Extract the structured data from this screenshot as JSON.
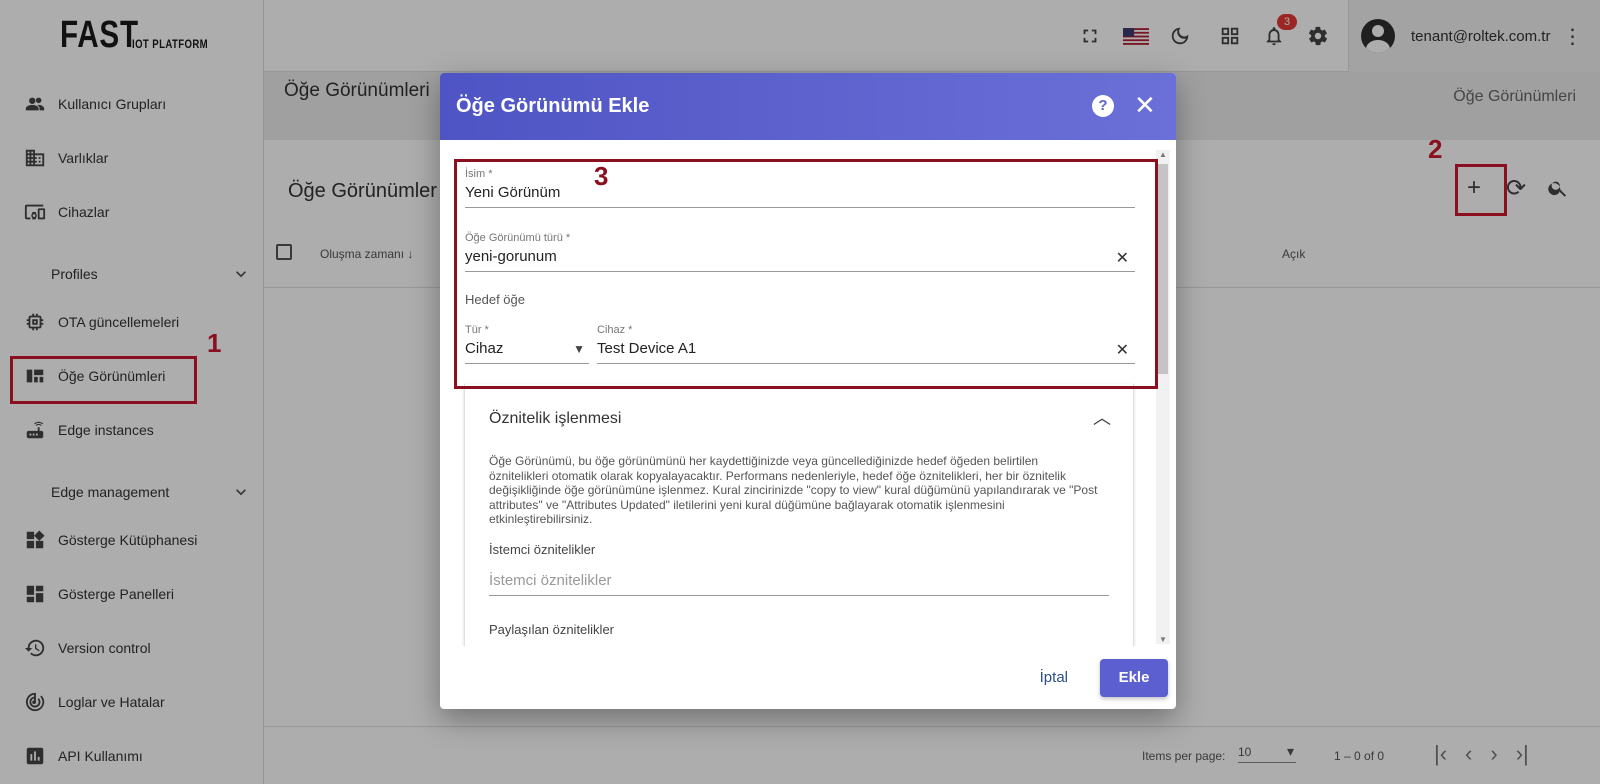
{
  "logo": {
    "main": "FAST",
    "sub": "IOT PLATFORM"
  },
  "sidebar": {
    "items": [
      {
        "label": "Kullanıcı Grupları",
        "icon": "user-group-icon"
      },
      {
        "label": "Varlıklar",
        "icon": "building-icon"
      },
      {
        "label": "Cihazlar",
        "icon": "devices-icon"
      },
      {
        "label": "Profiles",
        "icon": "chevron-down-icon",
        "group": true
      },
      {
        "label": "OTA güncellemeleri",
        "icon": "chip-icon"
      },
      {
        "label": "Öğe Görünümleri",
        "icon": "view-quilt-icon"
      },
      {
        "label": "Edge instances",
        "icon": "router-icon"
      },
      {
        "label": "Edge management",
        "icon": "chevron-down-icon",
        "group": true
      },
      {
        "label": "Gösterge Kütüphanesi",
        "icon": "widgets-icon"
      },
      {
        "label": "Gösterge Panelleri",
        "icon": "dashboard-icon"
      },
      {
        "label": "Version control",
        "icon": "history-icon"
      },
      {
        "label": "Loglar ve Hatalar",
        "icon": "track-changes-icon"
      },
      {
        "label": "API Kullanımı",
        "icon": "bar-chart-icon"
      }
    ]
  },
  "topbar": {
    "notification_count": "3",
    "user_email": "tenant@roltek.com.tr"
  },
  "page": {
    "title": "Öğe Görünümleri",
    "breadcrumb": "Öğe Görünümleri",
    "card_title": "Öğe Görünümler",
    "col_created": "Oluşma zamanı",
    "col_open": "Açık",
    "items_per_page_label": "Items per page:",
    "items_per_page": "10",
    "range": "1 – 0 of 0"
  },
  "dialog": {
    "title": "Öğe Görünümü Ekle",
    "name_label": "İsim *",
    "name_value": "Yeni Görünüm",
    "type_label": "Öğe Görünümü türü *",
    "type_value": "yeni-gorunum",
    "target_label": "Hedef öğe",
    "kind_label": "Tür *",
    "kind_value": "Cihaz",
    "device_label": "Cihaz *",
    "device_value": "Test Device A1",
    "attr_section": "Öznitelik işlenmesi",
    "attr_desc": "Öğe Görünümü, bu öğe görünümünü her kaydettiğinizde veya güncellediğinizde hedef öğeden belirtilen öznitelikleri otomatik olarak kopyalayacaktır. Performans nedenleriyle, hedef öğe öznitelikleri, her bir öznitelik değişikliğinde öğe görünümüne işlenmez. Kural zincirinizde \"copy to view\" kural düğümünü yapılandırarak ve \"Post attributes\" ve \"Attributes Updated\" iletilerini yeni kural düğümüne bağlayarak otomatik işlenmesini etkinleştirebilirsiniz.",
    "client_attr_label": "İstemci öznitelikler",
    "client_attr_placeholder": "İstemci öznitelikler",
    "shared_attr_label": "Paylaşılan öznitelikler",
    "cancel": "İptal",
    "add": "Ekle"
  },
  "annotations": {
    "one": "1",
    "two": "2",
    "three": "3"
  },
  "colors": {
    "accent": "#5b5fd0",
    "annotation": "#8b0f1f"
  }
}
